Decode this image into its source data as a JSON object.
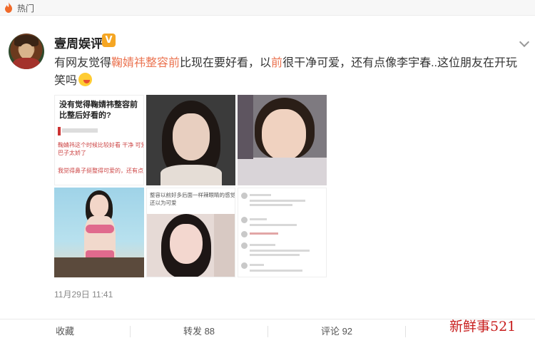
{
  "topbar": {
    "label": "热门",
    "icon": "fire-icon"
  },
  "post": {
    "author": "壹周娱评",
    "verified_badge": "V",
    "text_before": "有网友觉得",
    "highlight_topic": "鞠婧祎整容前",
    "text_middle": "比现在要好看，以",
    "highlight_word": "前",
    "text_after": "很干净可爱，还有点像李宇春..这位朋友在开玩笑吗",
    "emoji": "grinning-face-emoji",
    "timestamp": "11月29日 11:41"
  },
  "images": {
    "screenshot_title": "没有觉得鞠婧祎整容前比整后好看的?",
    "screenshot_line1": "鞠婧祎这个时候比较好看 干净 可爱 整容",
    "screenshot_line2": "巴子太娇了",
    "screenshot_line3": "我觉得鼻子挺整得可爱的，还有点像李宇",
    "caption_line1": "整容以前好多后面一样辣眼睛的感觉~",
    "caption_line2": "还以为可爱"
  },
  "actions": {
    "favorite_label": "收藏",
    "repost_label": "转发 88",
    "comment_label": "评论 92"
  },
  "watermark": "新鲜事521",
  "colors": {
    "highlight": "#eb7350",
    "badge": "#f5a623",
    "watermark": "#c81e1e"
  }
}
